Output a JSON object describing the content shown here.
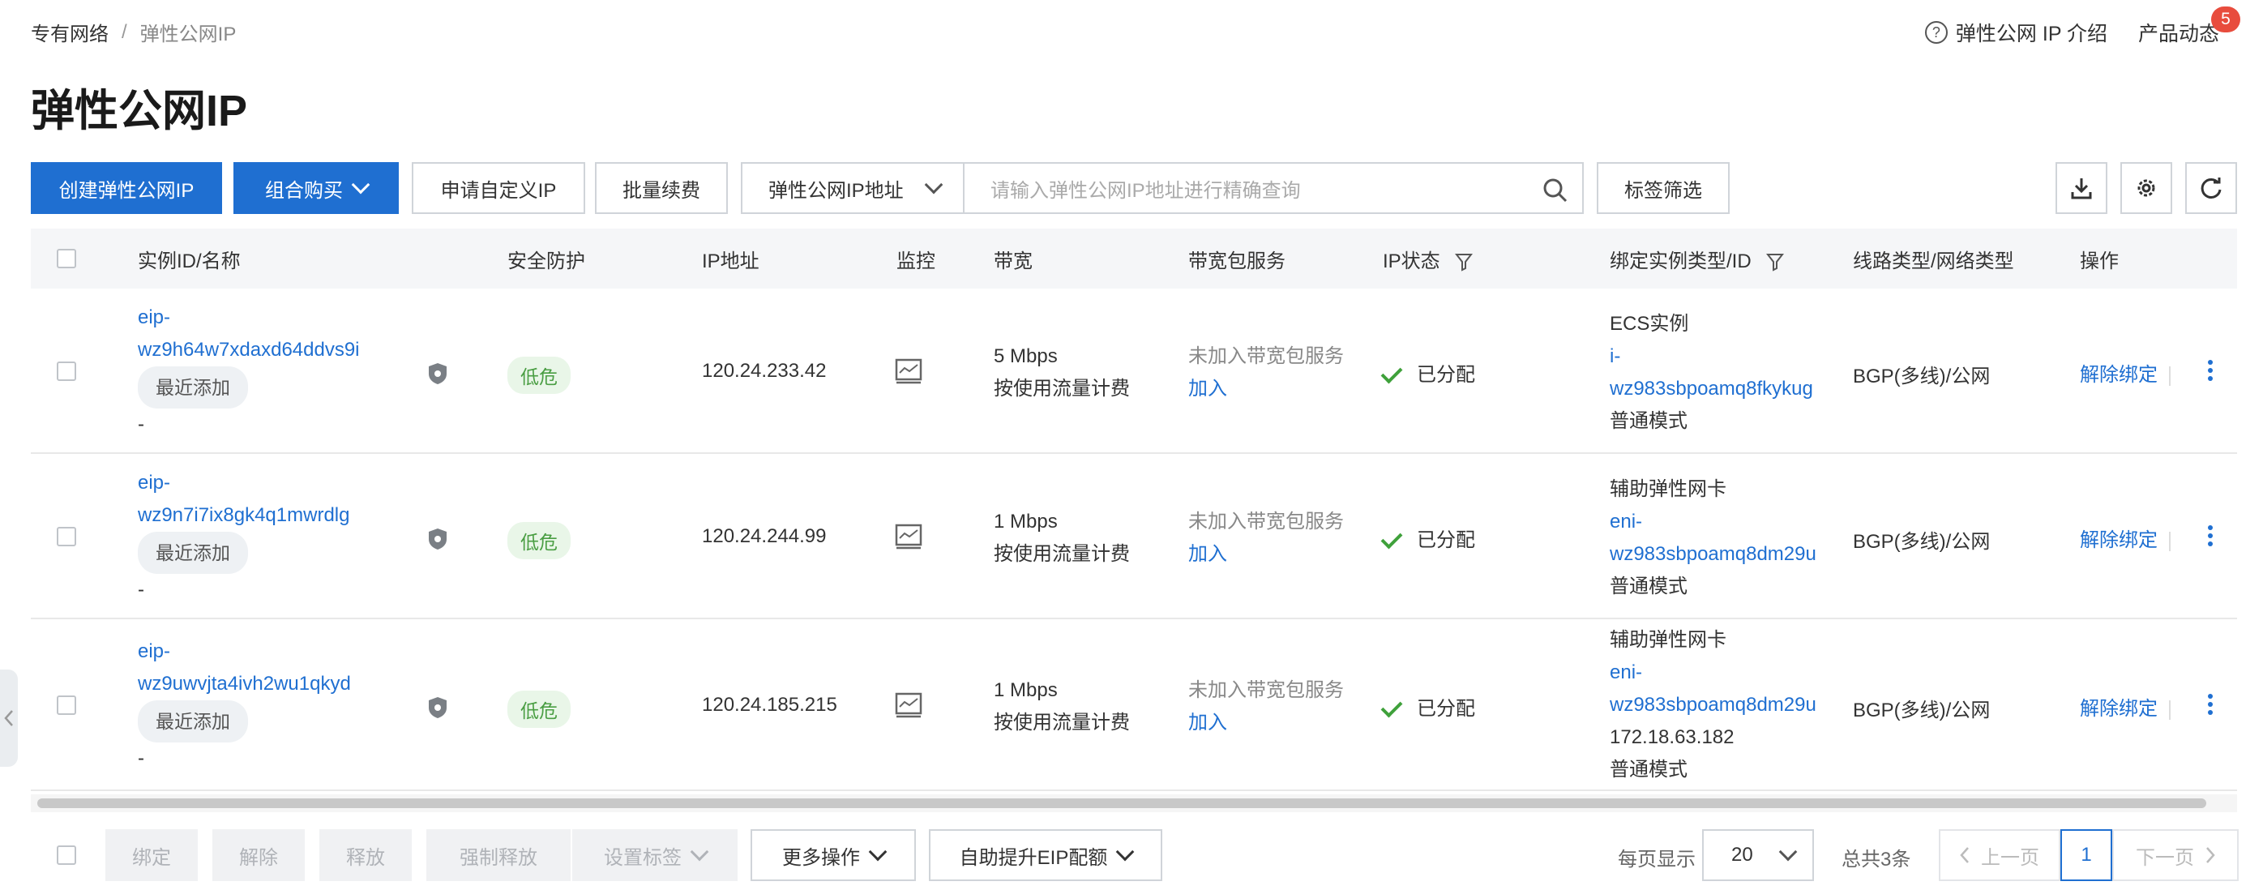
{
  "breadcrumb": {
    "parent": "专有网络",
    "separator": "/",
    "current": "弹性公网IP"
  },
  "header": {
    "help_label": "弹性公网 IP 介绍",
    "news_label": "产品动态",
    "news_badge": "5"
  },
  "page_title": "弹性公网IP",
  "toolbar": {
    "create_label": "创建弹性公网IP",
    "combo_label": "组合购买",
    "custom_ip_label": "申请自定义IP",
    "renew_label": "批量续费",
    "search_field": "弹性公网IP地址",
    "search_placeholder": "请输入弹性公网IP地址进行精确查询",
    "tag_filter_label": "标签筛选"
  },
  "icons": {
    "search": "search-icon",
    "download": "download-icon",
    "settings": "gear-icon",
    "refresh": "refresh-icon",
    "monitor": "monitor-icon",
    "shield": "shield-icon",
    "filter": "filter-icon",
    "more": "more-vertical-icon"
  },
  "table": {
    "columns": [
      "实例ID/名称",
      "安全防护",
      "IP地址",
      "监控",
      "带宽",
      "带宽包服务",
      "IP状态",
      "绑定实例类型/ID",
      "线路类型/网络类型",
      "操作"
    ],
    "rows": [
      {
        "id_line1": "eip-",
        "id_line2": "wz9h64w7xdaxd64ddvs9i",
        "tag": "最近添加",
        "name": "-",
        "risk": "低危",
        "ip": "120.24.233.42",
        "bandwidth": "5 Mbps",
        "billing": "按使用流量计费",
        "pkg_status": "未加入带宽包服务",
        "pkg_action": "加入",
        "status": "已分配",
        "instance_type": "ECS实例",
        "instance_id_line1": "i-",
        "instance_id_line2": "wz983sbpoamq8fkykug",
        "instance_extra": "",
        "mode": "普通模式",
        "line_type": "BGP(多线)/公网",
        "op_label": "解除绑定"
      },
      {
        "id_line1": "eip-",
        "id_line2": "wz9n7i7ix8gk4q1mwrdlg",
        "tag": "最近添加",
        "name": "-",
        "risk": "低危",
        "ip": "120.24.244.99",
        "bandwidth": "1 Mbps",
        "billing": "按使用流量计费",
        "pkg_status": "未加入带宽包服务",
        "pkg_action": "加入",
        "status": "已分配",
        "instance_type": "辅助弹性网卡",
        "instance_id_line1": "eni-",
        "instance_id_line2": "wz983sbpoamq8dm29u",
        "instance_extra": "",
        "mode": "普通模式",
        "line_type": "BGP(多线)/公网",
        "op_label": "解除绑定"
      },
      {
        "id_line1": "eip-",
        "id_line2": "wz9uwvjta4ivh2wu1qkyd",
        "tag": "最近添加",
        "name": "-",
        "risk": "低危",
        "ip": "120.24.185.215",
        "bandwidth": "1 Mbps",
        "billing": "按使用流量计费",
        "pkg_status": "未加入带宽包服务",
        "pkg_action": "加入",
        "status": "已分配",
        "instance_type": "辅助弹性网卡",
        "instance_id_line1": "eni-",
        "instance_id_line2": "wz983sbpoamq8dm29u",
        "instance_extra": "172.18.63.182",
        "mode": "普通模式",
        "line_type": "BGP(多线)/公网",
        "op_label": "解除绑定"
      }
    ]
  },
  "footer": {
    "bind": "绑定",
    "unbind": "解除",
    "release": "释放",
    "force_release": "强制释放",
    "set_tags": "设置标签",
    "more_ops": "更多操作",
    "quota": "自助提升EIP配额",
    "page_size_label": "每页显示",
    "page_size": "20",
    "total": "总共3条",
    "prev": "上一页",
    "current_page": "1",
    "next": "下一页"
  },
  "colors": {
    "primary": "#1f6fd1",
    "badge": "#e84c3d",
    "success": "#3fa13b",
    "risk_bg": "#e9f6e8"
  }
}
